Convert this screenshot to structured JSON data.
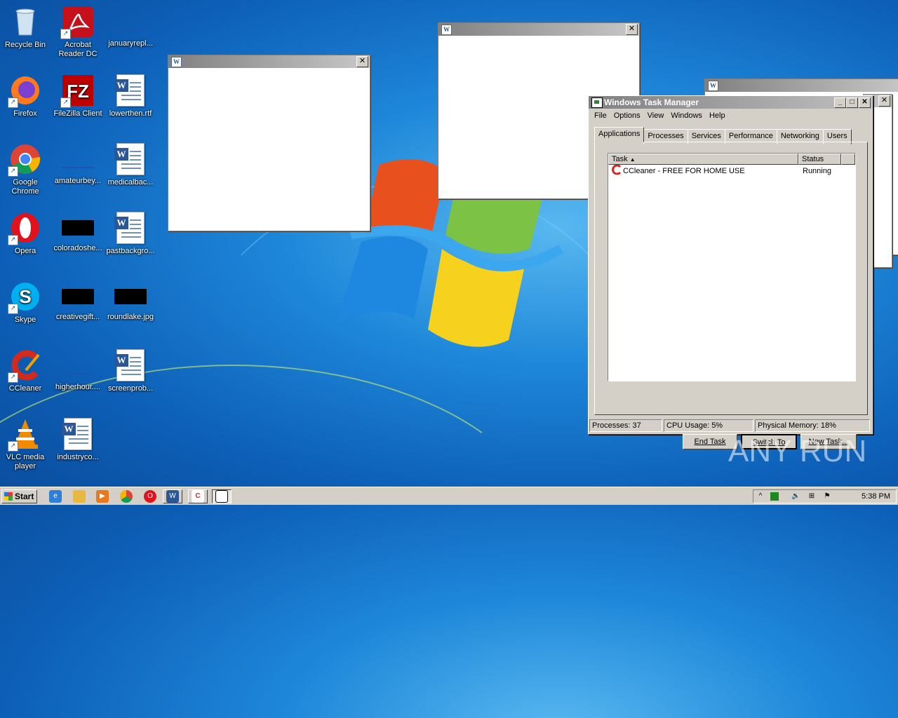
{
  "desktop": {
    "icons": [
      {
        "label": "Recycle Bin"
      },
      {
        "label": "Acrobat Reader DC"
      },
      {
        "label": "januaryrepl..."
      },
      {
        "label": "Firefox"
      },
      {
        "label": "FileZilla Client"
      },
      {
        "label": "lowerthen.rtf"
      },
      {
        "label": "Google Chrome"
      },
      {
        "label": "amateurbey..."
      },
      {
        "label": "medicalbac..."
      },
      {
        "label": "Opera"
      },
      {
        "label": "coloradoshe..."
      },
      {
        "label": "pastbackgro..."
      },
      {
        "label": "Skype"
      },
      {
        "label": "creativegift..."
      },
      {
        "label": "roundlake.jpg"
      },
      {
        "label": "CCleaner"
      },
      {
        "label": "higherhour...."
      },
      {
        "label": "screenprob..."
      },
      {
        "label": "VLC media player"
      },
      {
        "label": "industryco..."
      }
    ],
    "watermark": "ANY RUN"
  },
  "taskmanager": {
    "title": "Windows Task Manager",
    "menu": [
      "File",
      "Options",
      "View",
      "Windows",
      "Help"
    ],
    "tabs": [
      "Applications",
      "Processes",
      "Services",
      "Performance",
      "Networking",
      "Users"
    ],
    "columns": {
      "task": "Task",
      "status": "Status"
    },
    "rows": [
      {
        "task": "CCleaner - FREE FOR HOME USE",
        "status": "Running"
      }
    ],
    "buttons": {
      "end_task": "End Task",
      "switch_to": "Switch To",
      "new_task": "New Task..."
    },
    "status": {
      "processes": "Processes: 37",
      "cpu": "CPU Usage: 5%",
      "memory": "Physical Memory: 18%"
    }
  },
  "taskbar": {
    "start": "Start",
    "clock": "5:38 PM"
  }
}
